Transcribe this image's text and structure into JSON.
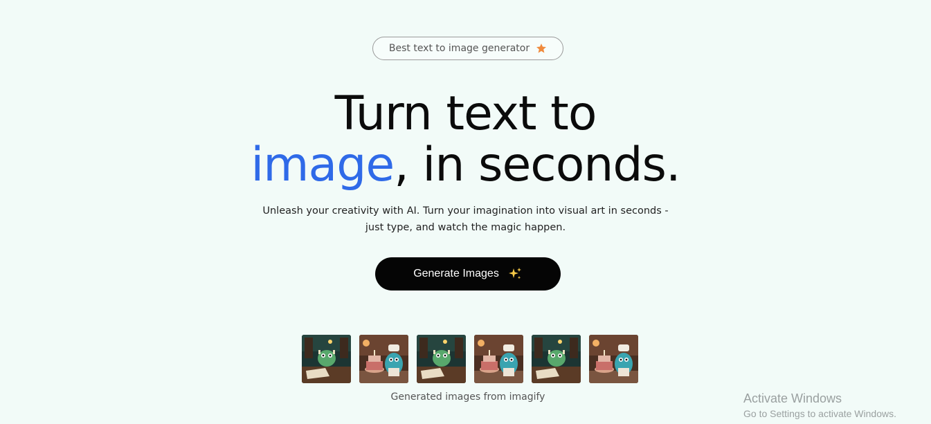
{
  "badge": {
    "label": "Best text to image generator",
    "icon": "star-icon"
  },
  "hero": {
    "line1": "Turn text to",
    "accent_word": "image",
    "line2_rest": ", in seconds.",
    "accent_color": "#2f6ae8"
  },
  "subtitle": {
    "line1": "Unleash your creativity with AI. Turn your imagination into visual art in seconds -",
    "line2": "just type, and watch the magic happen."
  },
  "cta": {
    "label": "Generate Images",
    "icon": "sparkle-icon"
  },
  "gallery": {
    "images": [
      "monster-library",
      "monster-cake",
      "monster-library",
      "monster-cake",
      "monster-library",
      "monster-cake"
    ],
    "caption": "Generated images from imagify"
  },
  "watermark": {
    "title": "Activate Windows",
    "subtitle": "Go to Settings to activate Windows."
  }
}
